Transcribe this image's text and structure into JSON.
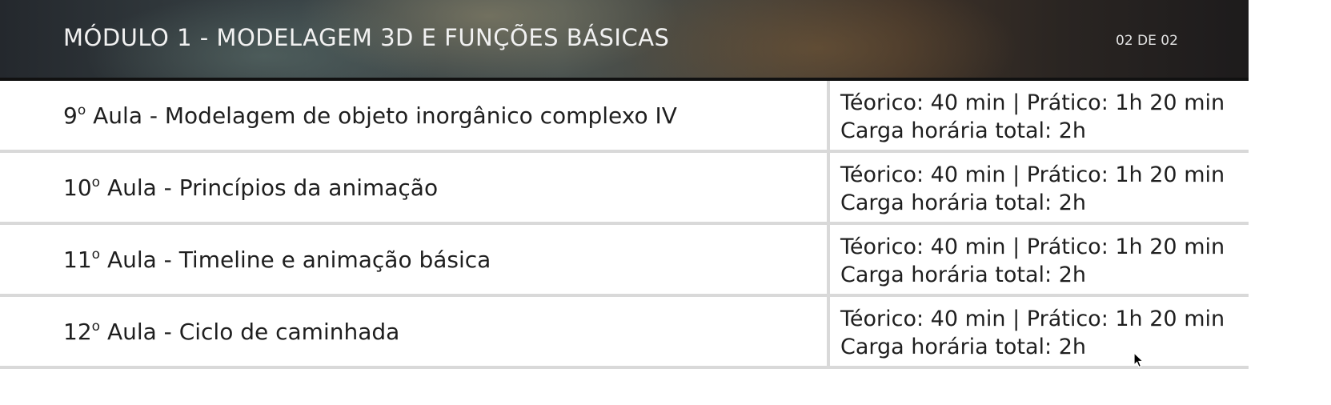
{
  "header": {
    "title": "MÓDULO 1 - MODELAGEM 3D E FUNÇÕES BÁSICAS",
    "page_indicator": "02 DE 02"
  },
  "lessons": [
    {
      "number": "9",
      "ordinal": "o",
      "title": " Aula - Modelagem de objeto inorgânico complexo IV",
      "timing": "Téorico: 40 min | Prático: 1h 20 min",
      "total": "Carga horária total: 2h"
    },
    {
      "number": "10",
      "ordinal": "o",
      "title": " Aula - Princípios da animação",
      "timing": "Téorico: 40 min | Prático: 1h 20 min",
      "total": "Carga horária total: 2h"
    },
    {
      "number": "11",
      "ordinal": "o",
      "title": " Aula - Timeline e animação básica",
      "timing": "Téorico: 40 min | Prático: 1h 20 min",
      "total": "Carga horária total: 2h"
    },
    {
      "number": "12",
      "ordinal": "o",
      "title": " Aula - Ciclo de caminhada",
      "timing": "Téorico: 40 min | Prático: 1h 20 min",
      "total": "Carga horária total: 2h"
    }
  ],
  "cursor": {
    "icon": "mouse-pointer-icon"
  }
}
